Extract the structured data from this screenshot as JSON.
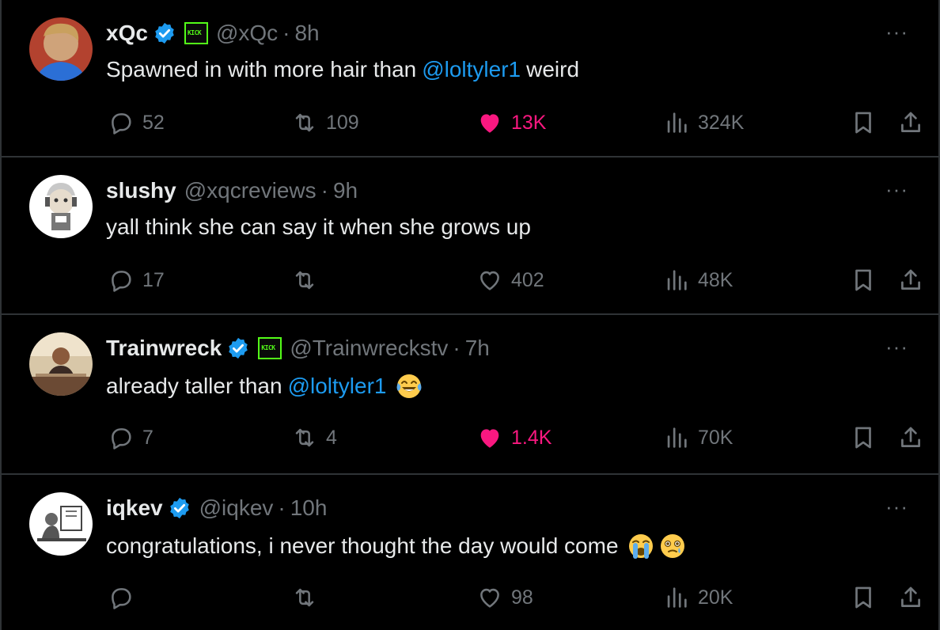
{
  "tweets": [
    {
      "name": "xQc",
      "verified": true,
      "kick_badge": true,
      "kick_label": "KICK",
      "handle": "@xQc",
      "time": "8h",
      "text_before": "Spawned in with more hair than",
      "mention": "@loltyler1",
      "text_after": "weird",
      "emojis": [],
      "replies": "52",
      "retweets": "109",
      "likes": "13K",
      "liked": true,
      "views": "324K"
    },
    {
      "name": "slushy",
      "verified": false,
      "kick_badge": false,
      "handle": "@xqcreviews",
      "time": "9h",
      "text_before": "yall think she can say it when she grows up",
      "mention": "",
      "text_after": "",
      "emojis": [],
      "replies": "17",
      "retweets": "",
      "likes": "402",
      "liked": false,
      "views": "48K"
    },
    {
      "name": "Trainwreck",
      "verified": true,
      "kick_badge": true,
      "kick_label": "KICK",
      "handle": "@Trainwreckstv",
      "time": "7h",
      "text_before": "already taller than",
      "mention": "@loltyler1",
      "text_after": "",
      "emojis": [
        "face-with-tears-of-joy"
      ],
      "replies": "7",
      "retweets": "4",
      "likes": "1.4K",
      "liked": true,
      "views": "70K"
    },
    {
      "name": "iqkev",
      "verified": true,
      "kick_badge": false,
      "handle": "@iqkev",
      "time": "10h",
      "text_before": "congratulations, i never thought the day would come",
      "mention": "",
      "text_after": "",
      "emojis": [
        "loudly-crying-face",
        "face-holding-back-tears"
      ],
      "replies": "",
      "retweets": "",
      "likes": "98",
      "liked": false,
      "views": "20K"
    }
  ],
  "colors": {
    "background": "#000000",
    "text": "#e7e9ea",
    "muted": "#71767b",
    "mention": "#1d9bf0",
    "like": "#f91880",
    "border": "#2f3336",
    "verified": "#1d9bf0",
    "kick": "#53fc18"
  },
  "icons": {
    "reply": "reply-icon",
    "retweet": "retweet-icon",
    "like": "heart-icon",
    "views": "views-icon",
    "bookmark": "bookmark-icon",
    "share": "share-icon",
    "more": "more-icon"
  },
  "ui": {
    "more_glyph": "···",
    "dot": "·"
  }
}
